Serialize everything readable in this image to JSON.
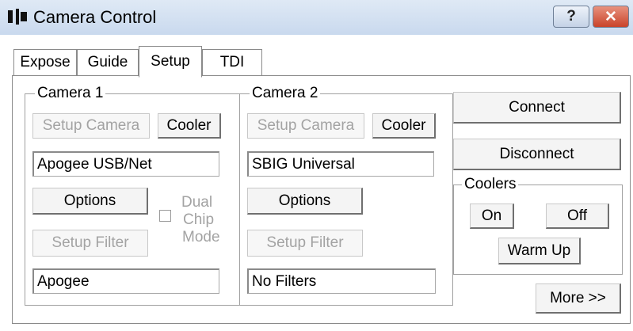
{
  "window": {
    "title": "Camera Control",
    "help_label": "?",
    "close_label": "✕"
  },
  "tabs": [
    {
      "label": "Expose"
    },
    {
      "label": "Guide"
    },
    {
      "label": "Setup",
      "active": true
    },
    {
      "label": "TDI"
    }
  ],
  "camera1": {
    "group_label": "Camera 1",
    "setup_camera_label": "Setup Camera",
    "cooler_label": "Cooler",
    "camera_model": "Apogee USB/Net",
    "options_label": "Options",
    "dual_chip_label_1": "Dual",
    "dual_chip_label_2": "Chip",
    "dual_chip_label_3": "Mode",
    "dual_chip_checked": false,
    "setup_filter_label": "Setup Filter",
    "filter_model": "Apogee"
  },
  "camera2": {
    "group_label": "Camera 2",
    "setup_camera_label": "Setup Camera",
    "cooler_label": "Cooler",
    "camera_model": "SBIG Universal",
    "options_label": "Options",
    "setup_filter_label": "Setup Filter",
    "filter_model": "No Filters"
  },
  "connection": {
    "connect_label": "Connect",
    "disconnect_label": "Disconnect"
  },
  "coolers": {
    "group_label": "Coolers",
    "on_label": "On",
    "off_label": "Off",
    "warm_up_label": "Warm Up"
  },
  "more_label": "More >>"
}
